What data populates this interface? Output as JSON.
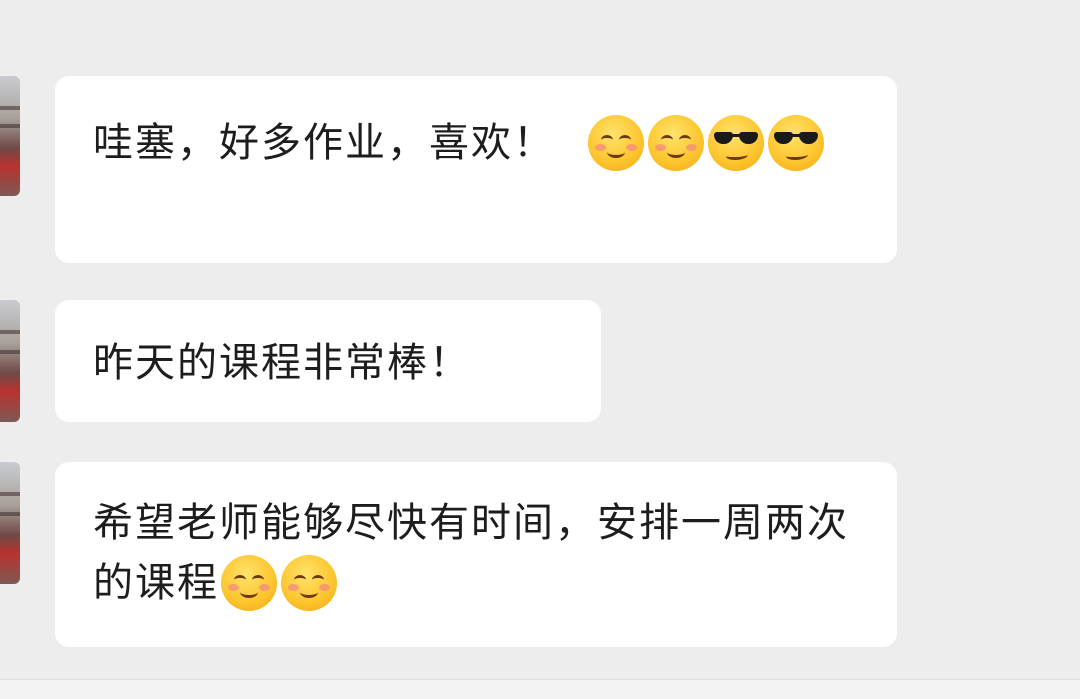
{
  "messages": [
    {
      "parts": [
        {
          "type": "text",
          "value": "哇塞，好多作业，喜欢！"
        },
        {
          "type": "emoji",
          "name": "smile-blush-emoji"
        },
        {
          "type": "emoji",
          "name": "smile-blush-emoji"
        },
        {
          "type": "emoji",
          "name": "sunglasses-emoji"
        },
        {
          "type": "emoji",
          "name": "sunglasses-emoji"
        }
      ]
    },
    {
      "parts": [
        {
          "type": "text",
          "value": "昨天的课程非常棒！"
        }
      ]
    },
    {
      "parts": [
        {
          "type": "text",
          "value": "希望老师能够尽快有时间，安排一周两次的课程"
        },
        {
          "type": "emoji",
          "name": "smile-blush-emoji"
        },
        {
          "type": "emoji",
          "name": "smile-blush-emoji"
        }
      ]
    }
  ],
  "colors": {
    "background": "#ededed",
    "bubble": "#ffffff",
    "text": "#1d1d1d"
  }
}
